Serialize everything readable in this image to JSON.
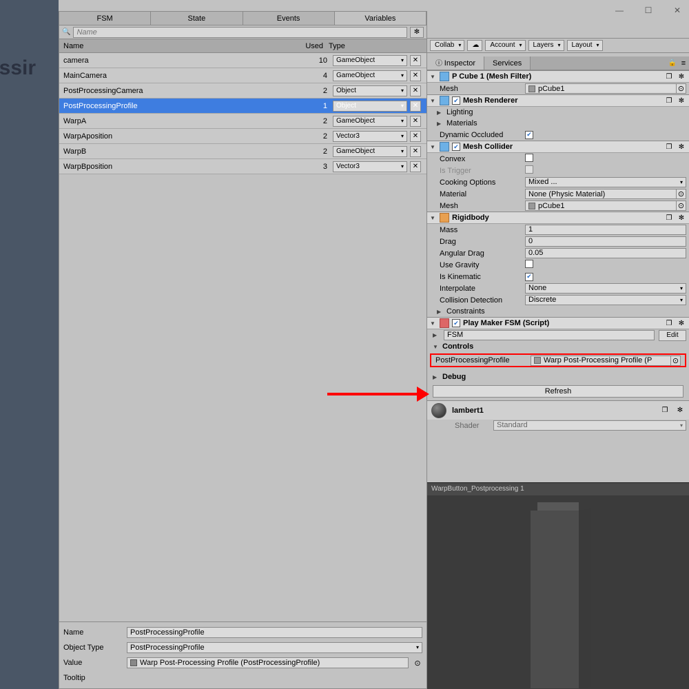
{
  "left": {
    "text": "essir"
  },
  "fsm": {
    "tabs": [
      "FSM",
      "State",
      "Events",
      "Variables"
    ],
    "activeTab": 3,
    "searchPlaceholder": "Name",
    "headers": {
      "name": "Name",
      "used": "Used",
      "type": "Type"
    },
    "selectedIndex": 3,
    "rows": [
      {
        "name": "camera",
        "used": "10",
        "type": "GameObject"
      },
      {
        "name": "MainCamera",
        "used": "4",
        "type": "GameObject"
      },
      {
        "name": "PostProcessingCamera",
        "used": "2",
        "type": "Object"
      },
      {
        "name": "PostProcessingProfile",
        "used": "1",
        "type": "Object"
      },
      {
        "name": "WarpA",
        "used": "2",
        "type": "GameObject"
      },
      {
        "name": "WarpAposition",
        "used": "2",
        "type": "Vector3"
      },
      {
        "name": "WarpB",
        "used": "2",
        "type": "GameObject"
      },
      {
        "name": "WarpBposition",
        "used": "3",
        "type": "Vector3"
      }
    ],
    "detail": {
      "nameLabel": "Name",
      "nameValue": "PostProcessingProfile",
      "objTypeLabel": "Object Type",
      "objTypeValue": "PostProcessingProfile",
      "valueLabel": "Value",
      "valueValue": "Warp Post-Processing Profile (PostProcessingProfile)",
      "tooltipLabel": "Tooltip"
    }
  },
  "topbar": {
    "collab": "Collab",
    "account": "Account",
    "layers": "Layers",
    "layout": "Layout"
  },
  "inspector": {
    "tabs": {
      "inspector": "Inspector",
      "services": "Services"
    },
    "meshFilter": {
      "title": "P Cube 1 (Mesh Filter)",
      "meshLabel": "Mesh",
      "meshValue": "pCube1"
    },
    "meshRenderer": {
      "title": "Mesh Renderer",
      "lighting": "Lighting",
      "materials": "Materials",
      "dynOcc": "Dynamic Occluded"
    },
    "meshCollider": {
      "title": "Mesh Collider",
      "convex": "Convex",
      "isTrigger": "Is Trigger",
      "cookingLabel": "Cooking Options",
      "cookingValue": "Mixed ...",
      "materialLabel": "Material",
      "materialValue": "None (Physic Material)",
      "meshLabel": "Mesh",
      "meshValue": "pCube1"
    },
    "rigidbody": {
      "title": "Rigidbody",
      "massLabel": "Mass",
      "massValue": "1",
      "dragLabel": "Drag",
      "dragValue": "0",
      "angDragLabel": "Angular Drag",
      "angDragValue": "0.05",
      "useGravLabel": "Use Gravity",
      "isKinLabel": "Is Kinematic",
      "interpLabel": "Interpolate",
      "interpValue": "None",
      "collDetLabel": "Collision Detection",
      "collDetValue": "Discrete",
      "constraints": "Constraints"
    },
    "playmaker": {
      "title": "Play Maker FSM (Script)",
      "fsmName": "FSM",
      "editBtn": "Edit",
      "controls": "Controls",
      "varLabel": "PostProcessingProfile",
      "varValue": "Warp Post-Processing Profile (P",
      "debug": "Debug",
      "refresh": "Refresh"
    },
    "material": {
      "name": "lambert1",
      "shaderLabel": "Shader",
      "shaderValue": "Standard"
    },
    "previewTitle": "WarpButton_Postprocessing 1"
  }
}
